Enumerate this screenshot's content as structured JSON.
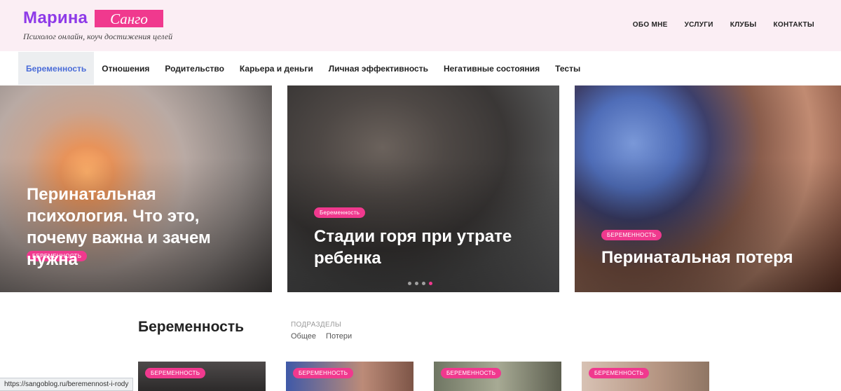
{
  "header": {
    "logo_first": "Марина",
    "logo_second": "Санго",
    "tagline": "Психолог онлайн, коуч достижения целей",
    "nav": [
      "ОБО МНЕ",
      "УСЛУГИ",
      "КЛУБЫ",
      "КОНТАКТЫ"
    ]
  },
  "categories": [
    {
      "label": "Беременность",
      "active": true
    },
    {
      "label": "Отношения"
    },
    {
      "label": "Родительство"
    },
    {
      "label": "Карьера и деньги"
    },
    {
      "label": "Личная эффективность"
    },
    {
      "label": "Негативные состояния"
    },
    {
      "label": "Тесты"
    }
  ],
  "slides": [
    {
      "badge": "БЕРЕМЕННОСТЬ",
      "title": "Перинатальная психология. Что это, почему важна и зачем нужна"
    },
    {
      "badge": "Беременность",
      "title": "Стадии горя при утрате ребенка"
    },
    {
      "badge": "БЕРЕМЕННОСТЬ",
      "title": "Перинатальная потеря"
    }
  ],
  "slider": {
    "dots": 4,
    "active_dot": 4
  },
  "section": {
    "title": "Беременность",
    "subs_heading": "ПОДРАЗДЕЛЫ",
    "subs": [
      "Общее",
      "Потери"
    ]
  },
  "thumbs": [
    "БЕРЕМЕННОСТЬ",
    "БЕРЕМЕННОСТЬ",
    "БЕРЕМЕННОСТЬ",
    "БЕРЕМЕННОСТЬ"
  ],
  "status_url": "https://sangoblog.ru/beremennost-i-rody",
  "colors": {
    "accent": "#f0398e",
    "logo": "#8e3ae8",
    "active_link": "#4a6cd8",
    "header_bg": "#fbeef4"
  }
}
